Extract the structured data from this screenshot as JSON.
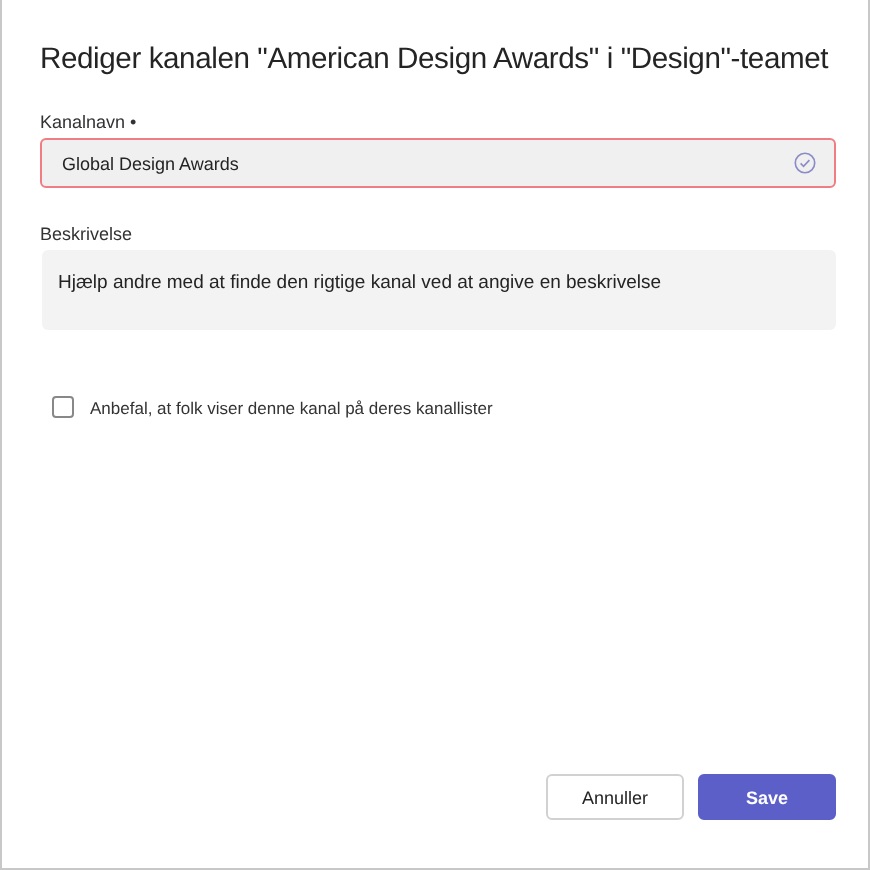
{
  "dialog": {
    "title": "Rediger kanalen \"American Design Awards\" i \"Design\"-teamet"
  },
  "name_field": {
    "label": "Kanalnavn •",
    "value": "Global Design Awards",
    "error": true,
    "valid": true
  },
  "description_field": {
    "label": "Beskrivelse",
    "placeholder": "Hjælp andre med at finde den rigtige kanal ved at angive en beskrivelse"
  },
  "recommend": {
    "label": "Anbefal, at folk viser denne kanal på deres kanallister",
    "checked": false
  },
  "buttons": [
    {
      "label": "Annuller",
      "kind": "secondary"
    },
    {
      "label": "Save",
      "kind": "primary"
    }
  ]
}
